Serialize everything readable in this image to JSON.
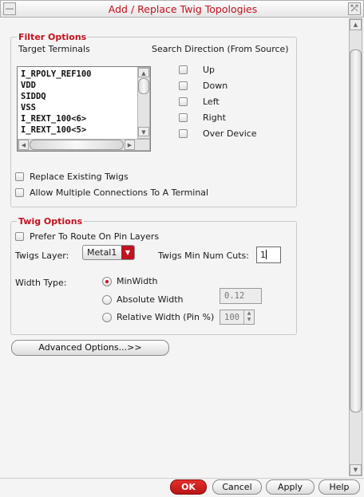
{
  "window": {
    "title": "Add / Replace Twig Topologies",
    "menu_glyph": "—",
    "close_glyph": "⤱"
  },
  "filter": {
    "legend": "Filter Options",
    "target_terminals_label": "Target Terminals",
    "search_direction_label": "Search Direction (From Source)",
    "terminals": [
      "I_RPOLY_REF100",
      "VDD",
      "SIDDQ",
      "VSS",
      "I_REXT_100<6>",
      "I_REXT_100<5>"
    ],
    "directions": [
      "Up",
      "Down",
      "Left",
      "Right",
      "Over Device"
    ],
    "replace_existing": "Replace Existing Twigs",
    "allow_multiple": "Allow Multiple Connections To A Terminal"
  },
  "twig": {
    "legend": "Twig Options",
    "prefer_pin_layers": "Prefer To Route On Pin Layers",
    "layer_label": "Twigs Layer:",
    "layer_value": "Metal1",
    "min_cuts_label": "Twigs Min Num Cuts:",
    "min_cuts_value": "1",
    "width_type_label": "Width Type:",
    "width_options": [
      "MinWidth",
      "Absolute Width",
      "Relative Width (Pin %)"
    ],
    "selected_width": "MinWidth",
    "absolute_width_value": "0.12",
    "relative_width_value": "100"
  },
  "advanced_button": "Advanced Options...>>",
  "footer": {
    "ok": "OK",
    "cancel": "Cancel",
    "apply": "Apply",
    "help": "Help"
  },
  "colors": {
    "accent": "#c1121f"
  }
}
